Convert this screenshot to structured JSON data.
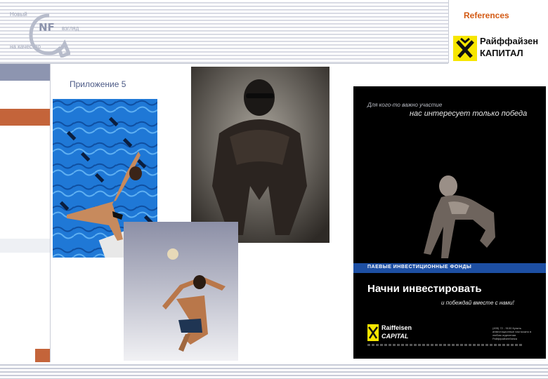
{
  "header": {
    "references_label": "References",
    "logo": {
      "word1": "Новый",
      "word2": "взгляд",
      "word3": "на качество",
      "letters": "NF"
    }
  },
  "brand": {
    "line1": "Райффайзен",
    "line2": "КАПИТАЛ"
  },
  "main": {
    "appendix_label": "Приложение 5"
  },
  "ad": {
    "line1": "Для кого-то важно участие",
    "line2": "нас интересует только победа",
    "bar": "ПАЕВЫЕ ИНВЕСТИЦИОННЫЕ ФОНДЫ",
    "headline": "Начни инвестировать",
    "subline": "и побеждай вместе с нами!",
    "logo1": "Raiffeisen",
    "logo2": "CAPITAL",
    "contact": "(495) 72 - 9100 Купить инвестиционные паи можно в любом отделении Райффайзенбанка"
  },
  "colors": {
    "accent": "#d35a14",
    "brand_yellow": "#f7e600",
    "ad_bar": "#1d4fa3",
    "stripe_grey": "#d9dbe4",
    "block_grey": "#8d95b0",
    "block_orange": "#c4643a"
  }
}
